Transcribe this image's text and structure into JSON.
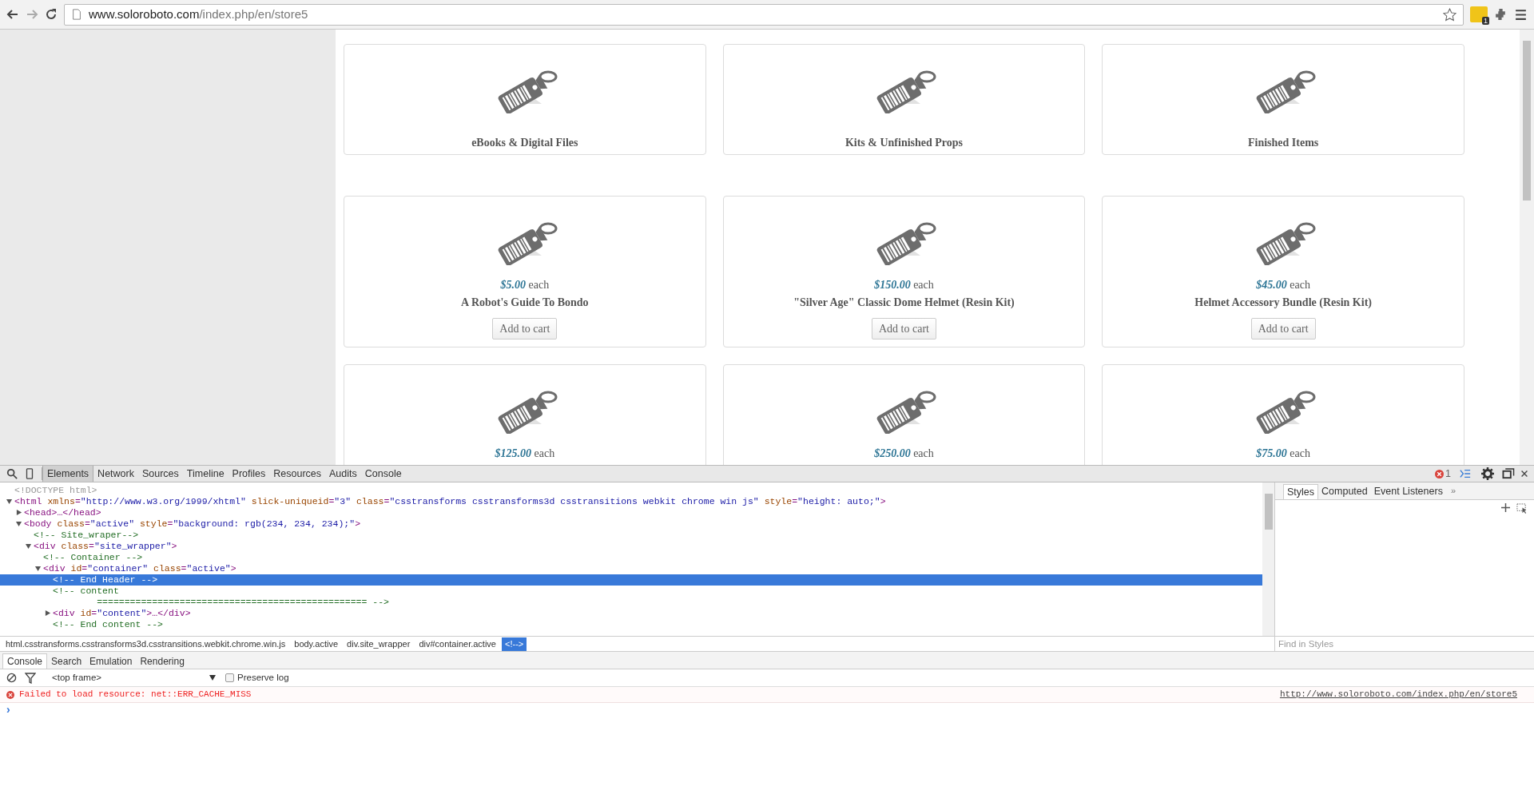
{
  "browser": {
    "url_domain": "www.soloroboto.com",
    "url_path": "/index.php/en/store5",
    "extension_badge": "1"
  },
  "store": {
    "rows": [
      {
        "cards": [
          {
            "kind": "category",
            "label": "eBooks & Digital Files"
          },
          {
            "kind": "category",
            "label": "Kits & Unfinished Props"
          },
          {
            "kind": "category",
            "label": "Finished Items"
          }
        ]
      },
      {
        "cards": [
          {
            "kind": "product",
            "price": "$5.00",
            "unit": "each",
            "name": "A Robot's Guide To Bondo",
            "button": "Add to cart"
          },
          {
            "kind": "product",
            "price": "$150.00",
            "unit": "each",
            "name": "\"Silver Age\" Classic Dome Helmet (Resin Kit)",
            "button": "Add to cart"
          },
          {
            "kind": "product",
            "price": "$45.00",
            "unit": "each",
            "name": "Helmet Accessory Bundle (Resin Kit)",
            "button": "Add to cart"
          }
        ]
      },
      {
        "cards": [
          {
            "kind": "product",
            "price": "$125.00",
            "unit": "each"
          },
          {
            "kind": "product",
            "price": "$250.00",
            "unit": "each"
          },
          {
            "kind": "product",
            "price": "$75.00",
            "unit": "each"
          }
        ]
      }
    ]
  },
  "devtools": {
    "tabs": [
      {
        "label": "Elements",
        "selected": true
      },
      {
        "label": "Network",
        "selected": false
      },
      {
        "label": "Sources",
        "selected": false
      },
      {
        "label": "Timeline",
        "selected": false
      },
      {
        "label": "Profiles",
        "selected": false
      },
      {
        "label": "Resources",
        "selected": false
      },
      {
        "label": "Audits",
        "selected": false
      },
      {
        "label": "Console",
        "selected": false
      }
    ],
    "error_count": "1",
    "dom_tree": [
      {
        "kind": "doctype",
        "text": "<!DOCTYPE html>",
        "selected": false
      },
      {
        "kind": "element",
        "text": "<html xmlns=\"http://www.w3.org/1999/xhtml\" slick-uniqueid=\"3\" class=\"csstransforms csstransforms3d csstransitions webkit chrome win js\" style=\"height: auto;\">",
        "expanded": true,
        "selected": false,
        "children": [
          {
            "kind": "element",
            "text": "<head>…</head>",
            "expanded": false,
            "selected": false
          },
          {
            "kind": "element",
            "text": "<body class=\"active\" style=\"background: rgb(234, 234, 234);\">",
            "expanded": true,
            "selected": false,
            "children": [
              {
                "kind": "comment",
                "text": "<!-- Site_wraper-->",
                "selected": false
              },
              {
                "kind": "element",
                "text": "<div class=\"site_wrapper\">",
                "expanded": true,
                "selected": false,
                "children": [
                  {
                    "kind": "comment",
                    "text": "<!-- Container -->",
                    "selected": false
                  },
                  {
                    "kind": "element",
                    "text": "<div id=\"container\" class=\"active\">",
                    "expanded": true,
                    "selected": false,
                    "children": [
                      {
                        "kind": "comment",
                        "text": "<!-- End Header -->",
                        "selected": true
                      },
                      {
                        "kind": "comment",
                        "text": "<!-- content\n        ================================================= -->",
                        "selected": false
                      },
                      {
                        "kind": "element",
                        "text": "<div id=\"content\">…</div>",
                        "expanded": false,
                        "selected": false
                      },
                      {
                        "kind": "comment",
                        "text": "<!-- End content -->",
                        "selected": false
                      }
                    ]
                  }
                ]
              }
            ]
          }
        ]
      }
    ],
    "breadcrumbs": [
      {
        "label": "html.csstransforms.csstransforms3d.csstransitions.webkit.chrome.win.js",
        "selected": false
      },
      {
        "label": "body.active",
        "selected": false
      },
      {
        "label": "div.site_wrapper",
        "selected": false
      },
      {
        "label": "div#container.active",
        "selected": false
      },
      {
        "label": "<!-->",
        "selected": true
      }
    ],
    "styles_tabs": [
      {
        "label": "Styles",
        "selected": true
      },
      {
        "label": "Computed",
        "selected": false
      },
      {
        "label": "Event Listeners",
        "selected": false
      }
    ],
    "styles_more": "»",
    "styles_filter": {
      "placeholder": "Find in Styles"
    },
    "drawer_tabs": [
      {
        "label": "Console",
        "selected": true
      },
      {
        "label": "Search",
        "selected": false
      },
      {
        "label": "Emulation",
        "selected": false
      },
      {
        "label": "Rendering",
        "selected": false
      }
    ],
    "console": {
      "frame": "<top frame>",
      "preserve_log": {
        "label": "Preserve log",
        "checked": false
      },
      "messages": [
        {
          "kind": "error",
          "text": "Failed to load resource: net::ERR_CACHE_MISS",
          "source": "http://www.soloroboto.com/index.php/en/store5"
        }
      ],
      "prompt": "›"
    }
  }
}
